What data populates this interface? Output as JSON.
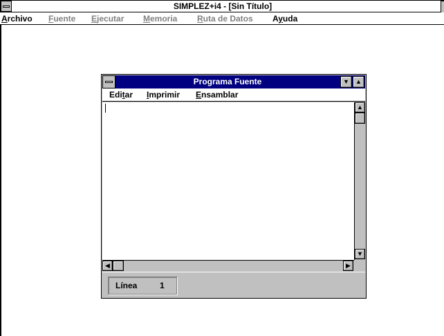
{
  "app": {
    "title": "SIMPLEZ+i4 - [Sin Título]",
    "menu": [
      {
        "label": "Archivo",
        "mnemonic": "A",
        "rest": "rchivo",
        "enabled": true
      },
      {
        "label": "Fuente",
        "mnemonic": "F",
        "rest": "uente",
        "enabled": false
      },
      {
        "label": "Ejecutar",
        "mnemonic": "E",
        "rest": "jecutar",
        "enabled": false
      },
      {
        "label": "Memoria",
        "mnemonic": "M",
        "rest": "emoria",
        "enabled": false
      },
      {
        "label": "Ruta de Datos",
        "mnemonic": "R",
        "rest": "uta de Datos",
        "enabled": false
      },
      {
        "label": "Ayuda",
        "pre": "A",
        "mnemonic": "y",
        "rest": "uda",
        "enabled": true
      }
    ]
  },
  "child": {
    "title": "Programa Fuente",
    "menu": [
      {
        "label": "Editar",
        "pre": "Edi",
        "mnemonic": "t",
        "rest": "ar"
      },
      {
        "label": "Imprimir",
        "pre": "",
        "mnemonic": "I",
        "rest": "mprimir"
      },
      {
        "label": "Ensamblar",
        "pre": "",
        "mnemonic": "E",
        "rest": "nsamblar"
      }
    ],
    "editor_text": "",
    "status": {
      "label": "Línea",
      "value": "1"
    }
  },
  "icons": {
    "minimize": "down-triangle-icon",
    "maximize": "up-triangle-icon",
    "scroll_up": "up-arrow-icon",
    "scroll_down": "down-arrow-icon",
    "scroll_left": "left-arrow-icon",
    "scroll_right": "right-arrow-icon"
  },
  "colors": {
    "active_titlebar": "#000080",
    "disabled_text": "#808080",
    "window_face": "#c0c0c0"
  }
}
